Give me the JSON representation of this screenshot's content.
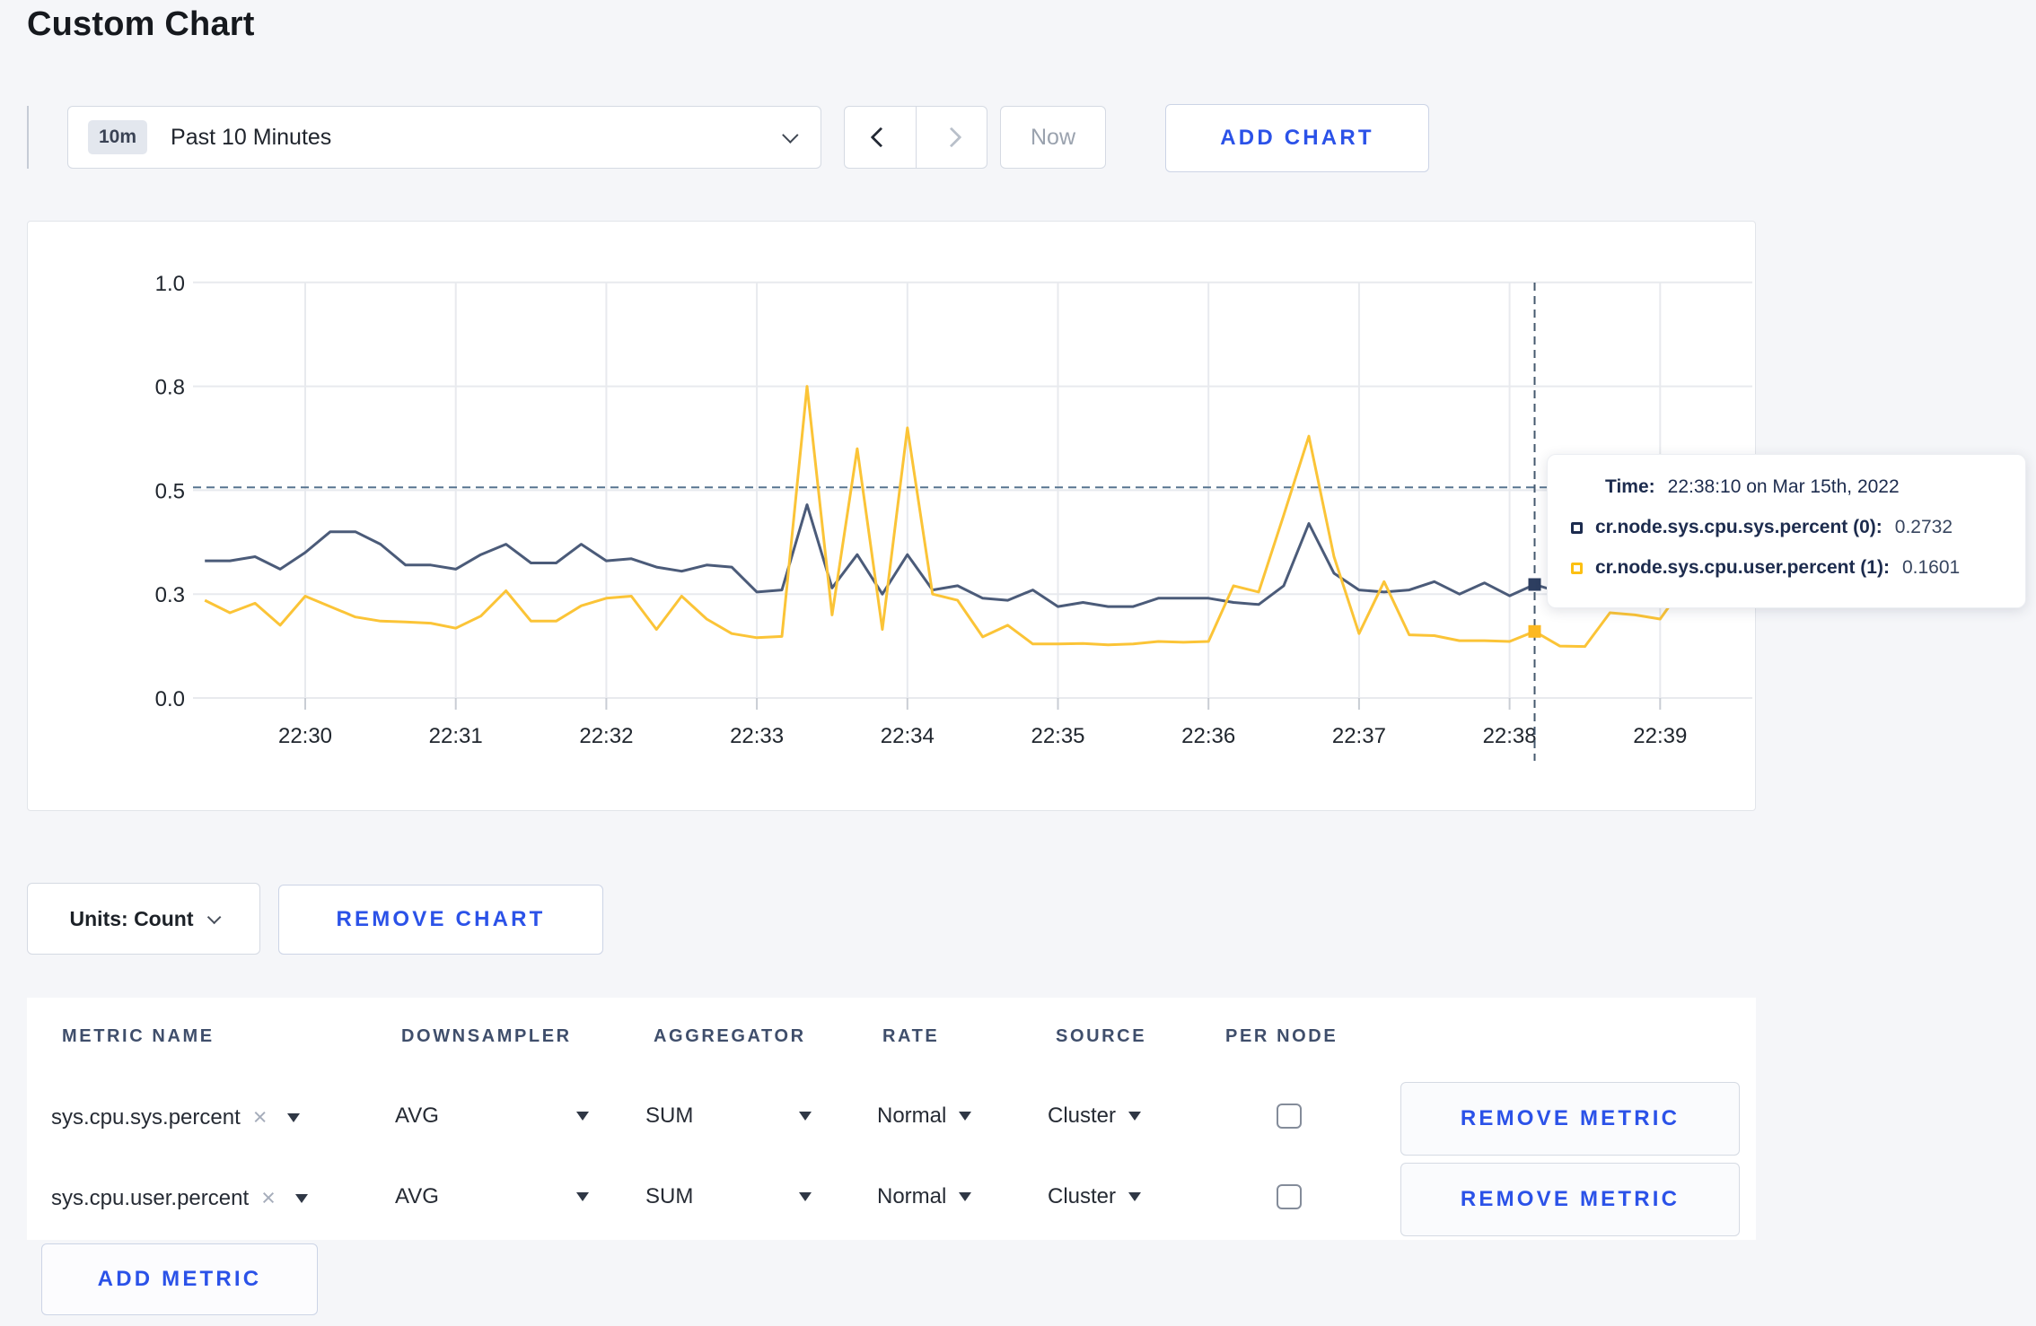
{
  "page": {
    "title": "Custom Chart"
  },
  "toolbar": {
    "range_badge": "10m",
    "range_label": "Past 10 Minutes",
    "now_label": "Now",
    "add_chart_label": "ADD CHART"
  },
  "chart": {
    "tooltip": {
      "time_label": "Time:",
      "time_value": "22:38:10 on Mar 15th, 2022",
      "rows": [
        {
          "name": "cr.node.sys.cpu.sys.percent (0):",
          "value": "0.2732",
          "swatch": "#1c2b4e"
        },
        {
          "name": "cr.node.sys.cpu.user.percent (1):",
          "value": "0.1601",
          "swatch": "#fcc012"
        }
      ]
    }
  },
  "chart_data": {
    "type": "line",
    "title": "",
    "units": "Count",
    "ylim": [
      0,
      1
    ],
    "grid": true,
    "legend_position": "tooltip-overlay",
    "x_start_label": "22:29:20",
    "interval_seconds": 10,
    "xticks": [
      "22:30",
      "22:31",
      "22:32",
      "22:33",
      "22:34",
      "22:35",
      "22:36",
      "22:37",
      "22:38",
      "22:39"
    ],
    "yticks": [
      {
        "label": "1.0",
        "value": 1.0
      },
      {
        "label": "0.8",
        "value": 0.75
      },
      {
        "label": "0.5",
        "value": 0.5
      },
      {
        "label": "0.3",
        "value": 0.25
      },
      {
        "label": "0.0",
        "value": 0.0
      }
    ],
    "crosshair": {
      "time_index": 53,
      "time_label": "22:38:10",
      "y_value": 0.507
    },
    "series": [
      {
        "name": "cr.node.sys.cpu.sys.percent (0)",
        "color": "#4b5b79",
        "dot_color": "#2d3e60",
        "hover_value": 0.2732,
        "values": [
          0.33,
          0.33,
          0.34,
          0.31,
          0.35,
          0.4,
          0.4,
          0.37,
          0.32,
          0.32,
          0.31,
          0.345,
          0.37,
          0.325,
          0.325,
          0.37,
          0.33,
          0.335,
          0.315,
          0.305,
          0.32,
          0.315,
          0.255,
          0.26,
          0.465,
          0.265,
          0.345,
          0.25,
          0.345,
          0.26,
          0.27,
          0.24,
          0.235,
          0.26,
          0.22,
          0.23,
          0.22,
          0.22,
          0.24,
          0.24,
          0.24,
          0.23,
          0.225,
          0.27,
          0.42,
          0.3,
          0.26,
          0.255,
          0.26,
          0.28,
          0.25,
          0.277,
          0.246,
          0.2732,
          0.255,
          0.26,
          0.27,
          0.26,
          0.27,
          0.28,
          0.27
        ]
      },
      {
        "name": "cr.node.sys.cpu.user.percent (1)",
        "color": "#fbc437",
        "dot_color": "#fcb822",
        "hover_value": 0.1601,
        "values": [
          0.235,
          0.205,
          0.228,
          0.175,
          0.245,
          0.22,
          0.195,
          0.185,
          0.183,
          0.18,
          0.168,
          0.197,
          0.258,
          0.185,
          0.185,
          0.222,
          0.24,
          0.245,
          0.165,
          0.245,
          0.19,
          0.155,
          0.145,
          0.148,
          0.75,
          0.2,
          0.6,
          0.165,
          0.65,
          0.25,
          0.235,
          0.147,
          0.175,
          0.13,
          0.13,
          0.131,
          0.128,
          0.13,
          0.136,
          0.134,
          0.136,
          0.27,
          0.255,
          0.44,
          0.63,
          0.34,
          0.155,
          0.28,
          0.152,
          0.15,
          0.138,
          0.138,
          0.136,
          0.1601,
          0.125,
          0.124,
          0.205,
          0.2,
          0.19,
          0.275,
          0.235
        ]
      }
    ]
  },
  "controls": {
    "units_label": "Units: Count",
    "remove_chart_label": "REMOVE CHART"
  },
  "icons": {
    "clear": "×"
  },
  "metrics_table": {
    "headers": [
      "METRIC NAME",
      "DOWNSAMPLER",
      "AGGREGATOR",
      "RATE",
      "SOURCE",
      "PER NODE"
    ],
    "rows": [
      {
        "metric": "sys.cpu.sys.percent",
        "downsampler": "AVG",
        "aggregator": "SUM",
        "rate": "Normal",
        "source": "Cluster",
        "per_node": false,
        "remove_label": "REMOVE METRIC"
      },
      {
        "metric": "sys.cpu.user.percent",
        "downsampler": "AVG",
        "aggregator": "SUM",
        "rate": "Normal",
        "source": "Cluster",
        "per_node": false,
        "remove_label": "REMOVE METRIC"
      }
    ],
    "add_metric_label": "ADD METRIC"
  }
}
